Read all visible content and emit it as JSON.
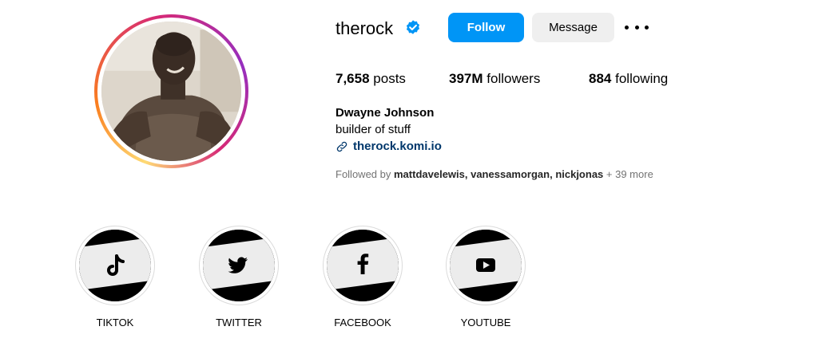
{
  "profile": {
    "username": "therock",
    "verified": true,
    "follow_label": "Follow",
    "message_label": "Message",
    "full_name": "Dwayne Johnson",
    "bio": "builder of stuff",
    "link": "therock.komi.io"
  },
  "stats": [
    {
      "count": "7,658",
      "label": "posts"
    },
    {
      "count": "397M",
      "label": "followers"
    },
    {
      "count": "884",
      "label": "following"
    }
  ],
  "followed_by": {
    "prefix": "Followed by",
    "names": "mattdavelewis, vanessamorgan, nickjonas",
    "suffix": "+ 39 more"
  },
  "highlights": [
    {
      "label": "TIKTOK",
      "icon": "tiktok-icon"
    },
    {
      "label": "TWITTER",
      "icon": "twitter-icon"
    },
    {
      "label": "FACEBOOK",
      "icon": "facebook-icon"
    },
    {
      "label": "YOUTUBE",
      "icon": "youtube-icon"
    }
  ],
  "colors": {
    "follow_button": "#0095f6",
    "message_button": "#efefef",
    "verified_badge": "#0095f6",
    "link": "#00376b",
    "muted_text": "#737373"
  }
}
